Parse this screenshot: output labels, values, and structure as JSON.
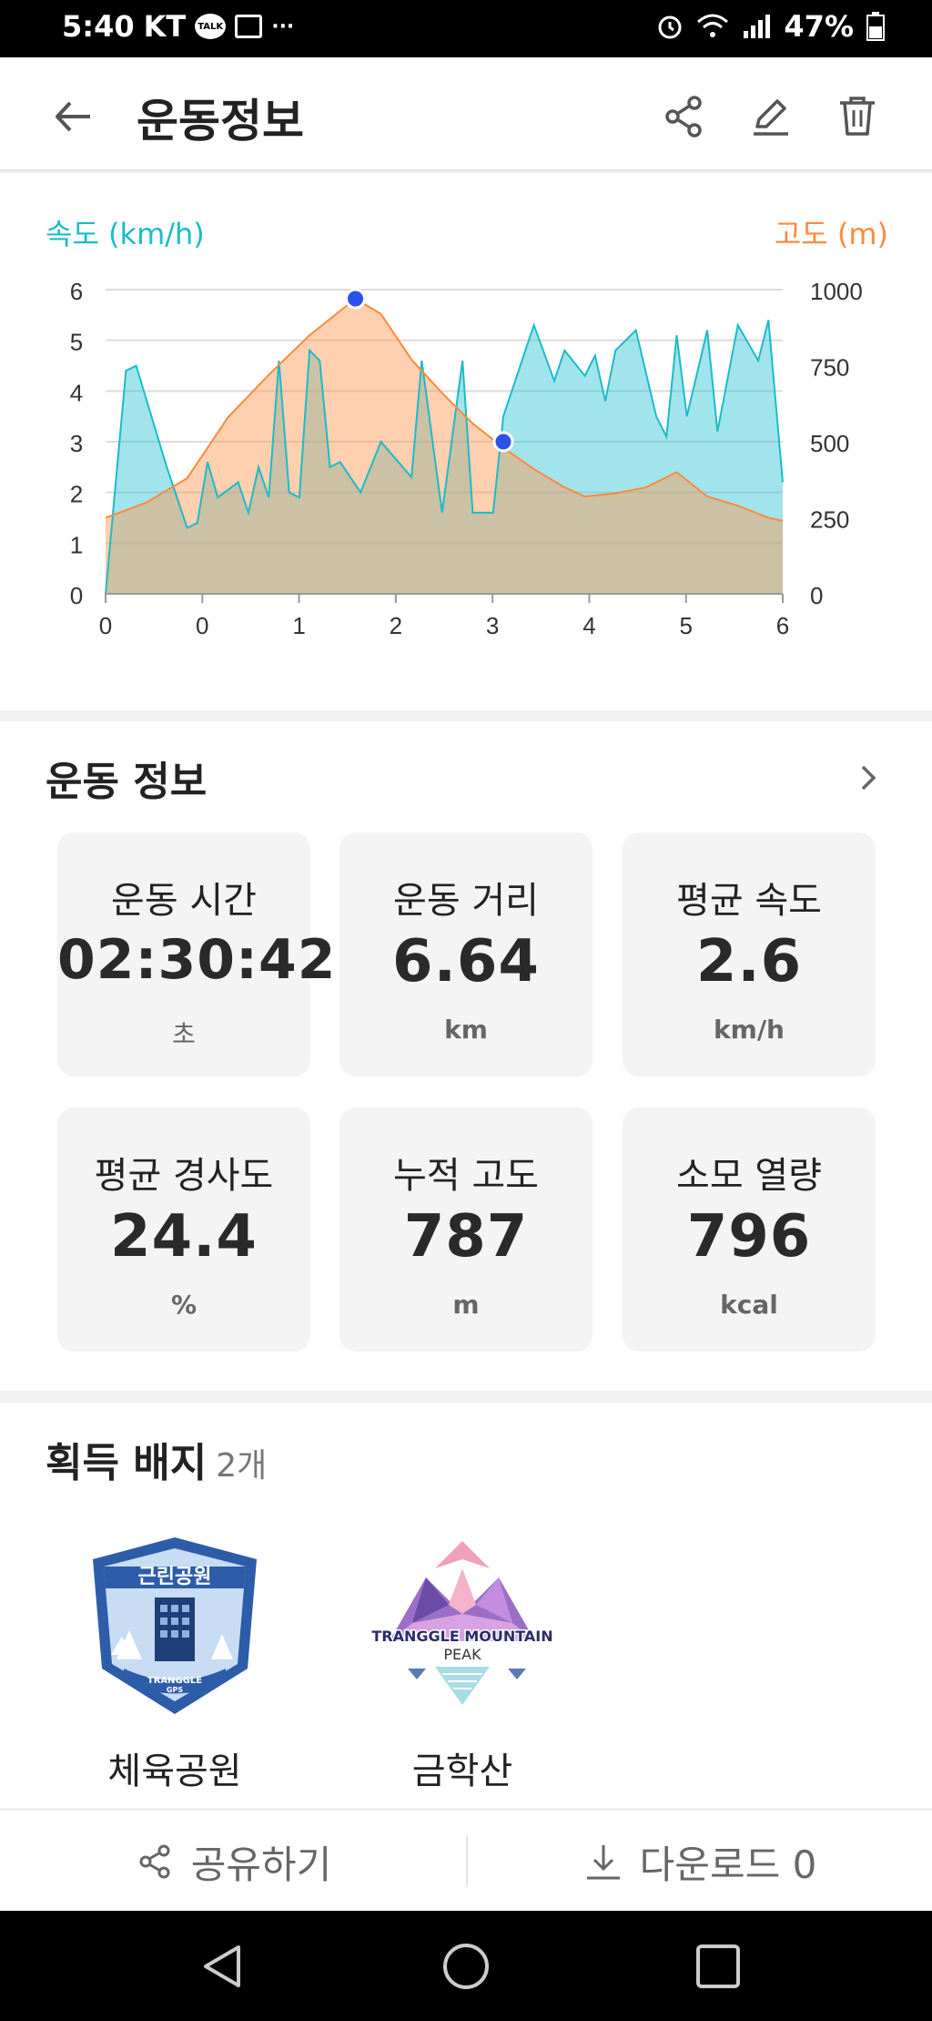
{
  "status_bar": {
    "time": "5:40",
    "carrier": "KT",
    "talk_badge": "TALK",
    "more": "···",
    "battery": "47%"
  },
  "header": {
    "title": "운동정보",
    "icons": [
      "back-arrow-icon",
      "share-icon",
      "edit-pencil-icon",
      "trash-icon"
    ]
  },
  "chart": {
    "left_label": "속도 (km/h)",
    "right_label": "고도 (m)",
    "left_color": "#1bbcc8",
    "right_color": "#ff8a3d",
    "left_ticks": [
      "6",
      "5",
      "4",
      "3",
      "2",
      "1",
      "0"
    ],
    "right_ticks": [
      "1000",
      "750",
      "500",
      "250",
      "0"
    ],
    "x_ticks": [
      "0",
      "0",
      "1",
      "2",
      "3",
      "4",
      "5",
      "6"
    ]
  },
  "chart_data": {
    "type": "area",
    "xlabel": "",
    "ylabel": "속도 (km/h)",
    "ylabel_right": "고도 (m)",
    "xlim": [
      0,
      6.64
    ],
    "ylim": [
      0,
      6
    ],
    "ylim_right": [
      0,
      1000
    ],
    "series": [
      {
        "name": "속도 (km/h)",
        "axis": "left",
        "color": "#1bbcc8",
        "x": [
          0,
          0.2,
          0.3,
          0.6,
          0.8,
          0.9,
          1.0,
          1.1,
          1.3,
          1.4,
          1.5,
          1.6,
          1.7,
          1.8,
          1.9,
          2.0,
          2.1,
          2.2,
          2.3,
          2.5,
          2.7,
          3.0,
          3.1,
          3.3,
          3.5,
          3.6,
          3.8,
          3.9,
          4.0,
          4.2,
          4.4,
          4.5,
          4.7,
          4.8,
          4.9,
          5.0,
          5.2,
          5.4,
          5.5,
          5.6,
          5.7,
          5.9,
          6.0,
          6.2,
          6.4,
          6.5,
          6.64
        ],
        "values": [
          0,
          4.4,
          4.5,
          2.5,
          1.3,
          1.4,
          2.6,
          1.9,
          2.2,
          1.6,
          2.5,
          1.9,
          4.6,
          2.0,
          1.9,
          4.8,
          4.6,
          2.5,
          2.6,
          2.0,
          3.0,
          2.3,
          4.6,
          1.6,
          4.6,
          1.6,
          1.6,
          3.5,
          4.1,
          5.3,
          4.2,
          4.8,
          4.3,
          4.7,
          3.8,
          4.8,
          5.2,
          3.5,
          3.1,
          5.1,
          3.5,
          5.2,
          3.2,
          5.3,
          4.6,
          5.4,
          2.2
        ]
      },
      {
        "name": "고도 (m)",
        "axis": "right",
        "color": "#ff8a3d",
        "x": [
          0,
          0.4,
          0.8,
          1.2,
          1.6,
          2.0,
          2.3,
          2.45,
          2.7,
          3.0,
          3.3,
          3.6,
          3.9,
          4.2,
          4.5,
          4.7,
          5.0,
          5.3,
          5.6,
          5.9,
          6.2,
          6.5,
          6.64
        ],
        "values": [
          250,
          300,
          380,
          580,
          720,
          850,
          930,
          970,
          920,
          770,
          660,
          560,
          480,
          410,
          350,
          320,
          330,
          350,
          400,
          320,
          290,
          250,
          240
        ]
      }
    ],
    "markers": [
      {
        "series": "고도 (m)",
        "x": 2.45,
        "y": 970
      },
      {
        "series": "속도 (km/h)",
        "x": 3.9,
        "y": 3.0
      }
    ],
    "grid": true
  },
  "exercise": {
    "section_title": "운동 정보",
    "stats": [
      {
        "label": "운동 시간",
        "value": "02:30:42",
        "unit": "초"
      },
      {
        "label": "운동 거리",
        "value": "6.64",
        "unit": "km"
      },
      {
        "label": "평균 속도",
        "value": "2.6",
        "unit": "km/h"
      },
      {
        "label": "평균 경사도",
        "value": "24.4",
        "unit": "%"
      },
      {
        "label": "누적 고도",
        "value": "787",
        "unit": "m"
      },
      {
        "label": "소모 열량",
        "value": "796",
        "unit": "kcal"
      }
    ]
  },
  "badges": {
    "section_title": "획득 배지",
    "count": "2개",
    "items": [
      {
        "name": "체육공원",
        "emblem_title": "근린공원",
        "emblem_sub": "TRANGGLE",
        "emblem_sub2": "GPS"
      },
      {
        "name": "금학산",
        "emblem_title": "TRANGGLE MOUNTAIN",
        "emblem_sub": "PEAK"
      }
    ]
  },
  "actions": {
    "share": "공유하기",
    "download": "다운로드 0"
  }
}
